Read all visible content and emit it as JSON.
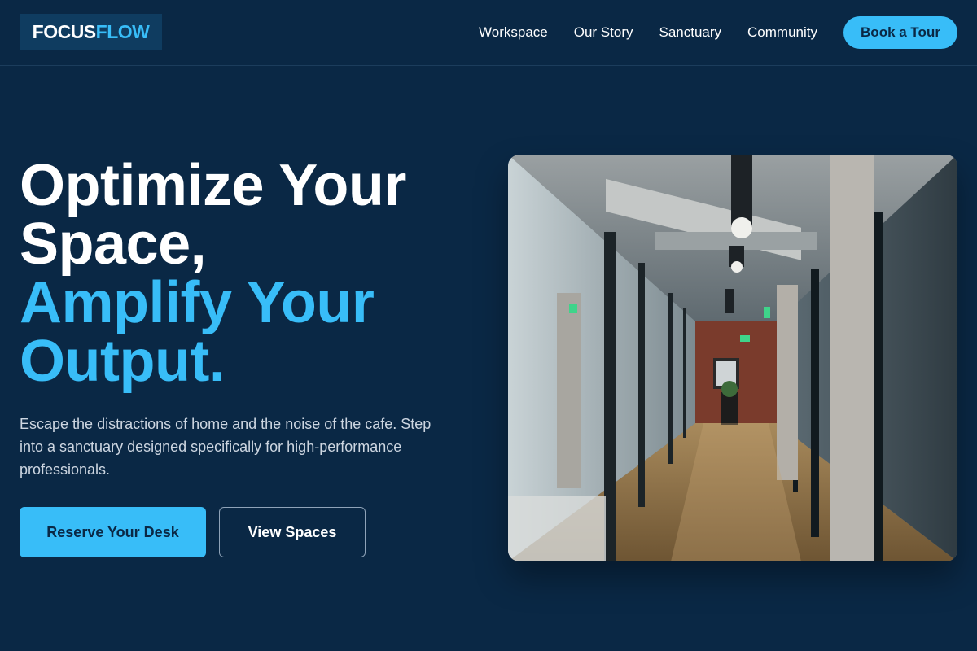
{
  "brand": {
    "logo_part1": "FOCUS",
    "logo_part2": "FLOW",
    "colors": {
      "background": "#0a2845",
      "accent": "#38bdf8",
      "logo_bg": "#0f3c60"
    }
  },
  "nav": {
    "links": [
      "Workspace",
      "Our Story",
      "Sanctuary",
      "Community"
    ],
    "cta_label": "Book a Tour"
  },
  "hero": {
    "title_line1": "Optimize Your",
    "title_line2": "Space,",
    "title_line3": "Amplify Your",
    "title_line4": "Output.",
    "subtitle": "Escape the distractions of home and the noise of the cafe. Step into a sanctuary designed specifically for high-performance professionals.",
    "primary_button": "Reserve Your Desk",
    "secondary_button": "View Spaces",
    "image_icon": "office-corridor-photo"
  }
}
